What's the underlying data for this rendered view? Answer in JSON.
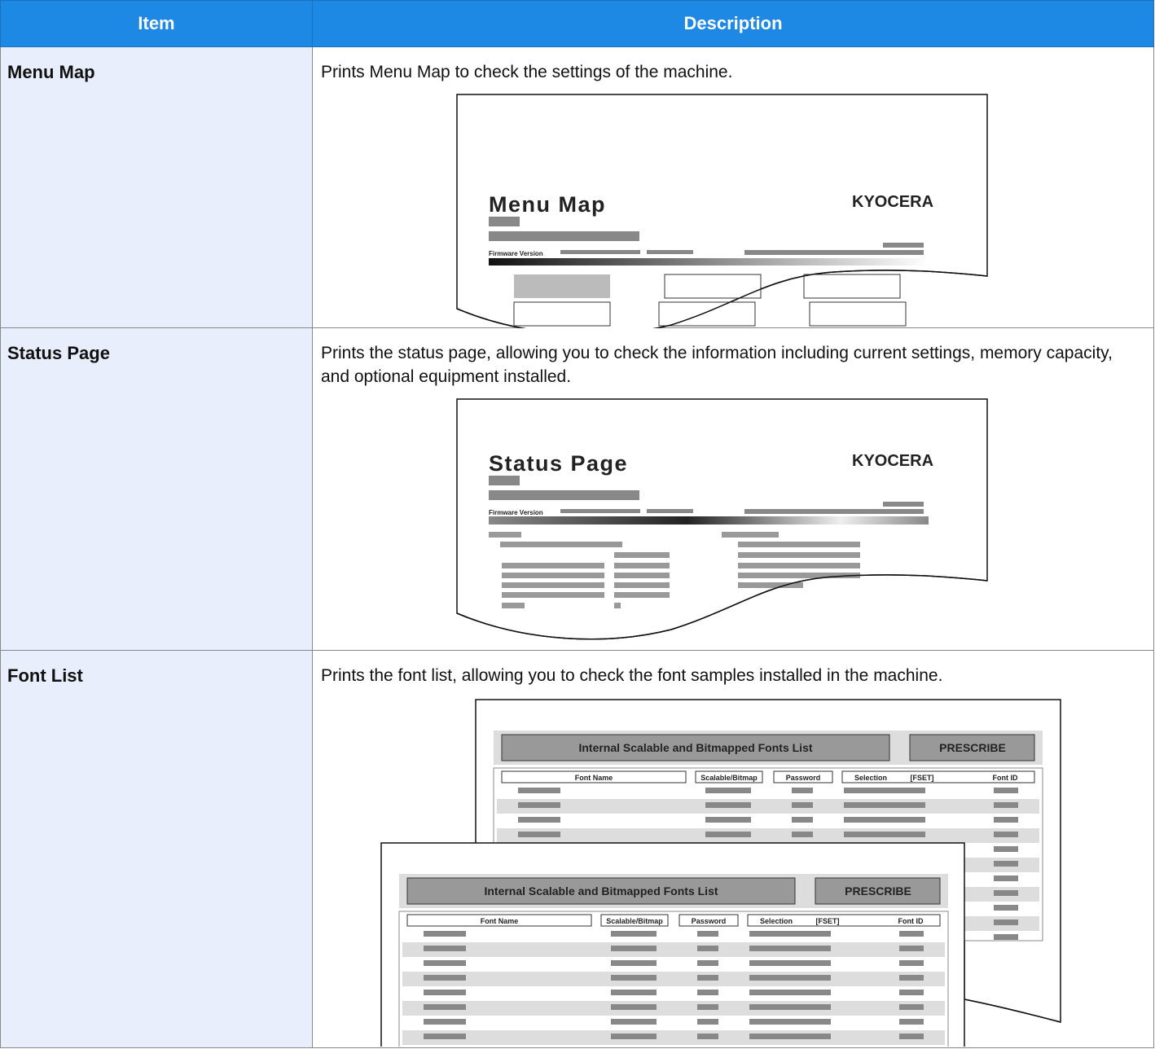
{
  "table": {
    "headers": {
      "item": "Item",
      "description": "Description"
    },
    "rows": [
      {
        "item": "Menu Map",
        "description": "Prints Menu Map to check the settings of the machine.",
        "illustration": {
          "title": "Menu Map",
          "brand": "KYOCERA",
          "firmware_label": "Firmware Version"
        }
      },
      {
        "item": "Status Page",
        "description": "Prints the status page, allowing you to check the information including current settings, memory capacity, and optional equipment installed.",
        "illustration": {
          "title": "Status Page",
          "brand": "KYOCERA",
          "firmware_label": "Firmware Version"
        }
      },
      {
        "item": "Font List",
        "description": "Prints the font list, allowing you to check the font samples installed in the machine.",
        "illustration": {
          "list_title": "Internal Scalable and Bitmapped Fonts List",
          "prescribe": "PRESCRIBE",
          "columns": [
            "Font Name",
            "Scalable/Bitmap",
            "Password",
            "Selection",
            "[FSET]",
            "Font ID"
          ]
        }
      }
    ]
  }
}
